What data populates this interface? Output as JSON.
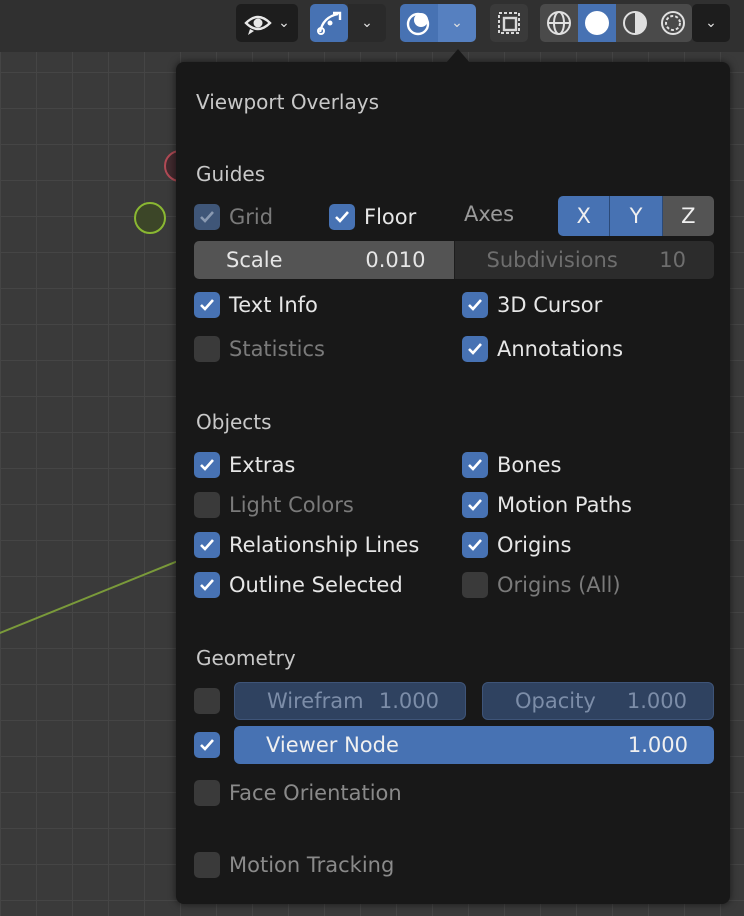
{
  "panel": {
    "title": "Viewport Overlays",
    "sections": {
      "guides": "Guides",
      "objects": "Objects",
      "geometry": "Geometry"
    },
    "guides": {
      "grid": "Grid",
      "floor": "Floor",
      "axes": "Axes",
      "axis_x": "X",
      "axis_y": "Y",
      "axis_z": "Z",
      "scale_label": "Scale",
      "scale_value": "0.010",
      "subdivisions_label": "Subdivisions",
      "subdivisions_value": "10",
      "text_info": "Text Info",
      "cursor_3d": "3D Cursor",
      "statistics": "Statistics",
      "annotations": "Annotations"
    },
    "objects": {
      "extras": "Extras",
      "bones": "Bones",
      "light_colors": "Light Colors",
      "motion_paths": "Motion Paths",
      "relationship_lines": "Relationship Lines",
      "origins": "Origins",
      "outline_selected": "Outline Selected",
      "origins_all": "Origins (All)"
    },
    "geometry": {
      "wireframe_label": "Wirefram",
      "wireframe_value": "1.000",
      "opacity_label": "Opacity",
      "opacity_value": "1.000",
      "viewer_node_label": "Viewer Node",
      "viewer_node_value": "1.000",
      "face_orientation": "Face Orientation",
      "motion_tracking": "Motion Tracking"
    }
  },
  "colors": {
    "accent": "#4772b3",
    "panel_bg": "#181818",
    "checkbox_off": "#545454"
  },
  "icons": [
    "visibility-eye-icon",
    "gizmo-icon",
    "overlay-icon",
    "xray-icon",
    "wireframe-shading-icon",
    "solid-shading-icon",
    "material-shading-icon",
    "rendered-shading-icon",
    "chevron-down-icon",
    "checkmark-icon"
  ]
}
